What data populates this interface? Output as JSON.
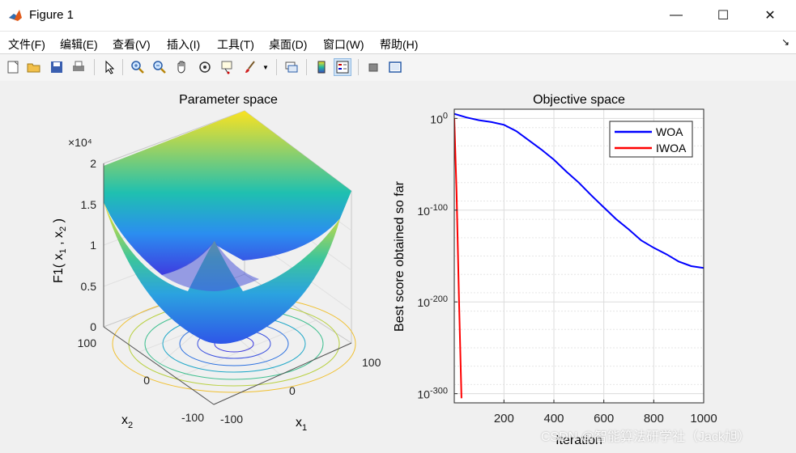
{
  "window": {
    "title": "Figure 1",
    "minimize": "—",
    "maximize": "☐",
    "close": "✕"
  },
  "menu": {
    "items": [
      "文件(F)",
      "编辑(E)",
      "查看(V)",
      "插入(I)",
      "工具(T)",
      "桌面(D)",
      "窗口(W)",
      "帮助(H)"
    ],
    "overflow_arrow": "↘"
  },
  "toolbar": {
    "buttons": [
      "new-figure",
      "open-file",
      "save",
      "print",
      "edit-plot-pointer",
      "zoom-in",
      "zoom-out",
      "pan",
      "rotate-3d",
      "data-cursor",
      "brush",
      "brush-dropdown",
      "link-plot",
      "colorbar",
      "legend",
      "hide-plot-tools",
      "show-plot-tools"
    ]
  },
  "left_plot": {
    "title": "Parameter space",
    "exponent": "×10⁴",
    "z_ticks": [
      "0",
      "0.5",
      "1",
      "1.5",
      "2"
    ],
    "zlabel": "F1( x",
    "zlabel_sub1": "1",
    "zlabel_mid": " , x",
    "zlabel_sub2": "2",
    "zlabel_end": " )",
    "x2_ticks": [
      "100",
      "0",
      "-100"
    ],
    "x1_ticks": [
      "-100",
      "0",
      "100"
    ],
    "x2_label": "x",
    "x2_label_sub": "2",
    "x1_label": "x",
    "x1_label_sub": "1",
    "colors": {
      "surface_low": "#3b4cc0",
      "surface_high": "#f9e221"
    }
  },
  "right_plot": {
    "title": "Objective space",
    "ylabel": "Best score obtained so far",
    "xlabel": "Iteration",
    "y_ticks": [
      {
        "base": "10",
        "exp": "0",
        "value": 0
      },
      {
        "base": "10",
        "exp": "-100",
        "value": -100
      },
      {
        "base": "10",
        "exp": "-200",
        "value": -200
      },
      {
        "base": "10",
        "exp": "-300",
        "value": -300
      }
    ],
    "x_ticks": [
      "200",
      "400",
      "600",
      "800",
      "1000"
    ]
  },
  "chart_data": {
    "type": "line",
    "title": "Objective space",
    "xlabel": "Iteration",
    "ylabel": "Best score obtained so far",
    "yscale": "log",
    "xlim": [
      1,
      1000
    ],
    "ylim_log10": [
      -310,
      10
    ],
    "legend": "top-right",
    "grid": true,
    "series": [
      {
        "name": "WOA",
        "color": "#0000ff",
        "x": [
          1,
          50,
          100,
          150,
          200,
          250,
          300,
          350,
          400,
          450,
          500,
          550,
          600,
          650,
          700,
          750,
          800,
          850,
          900,
          950,
          1000
        ],
        "log10_y": [
          5,
          1,
          -2,
          -4,
          -7,
          -14,
          -24,
          -34,
          -45,
          -58,
          -70,
          -84,
          -97,
          -110,
          -121,
          -133,
          -141,
          -148,
          -156,
          -161,
          -163
        ]
      },
      {
        "name": "IWOA",
        "color": "#ff0000",
        "x": [
          1,
          10,
          20,
          30
        ],
        "log10_y": [
          0,
          -80,
          -200,
          -305
        ]
      }
    ]
  },
  "watermark": "CSDN @智能算法研学社（Jack旭）"
}
